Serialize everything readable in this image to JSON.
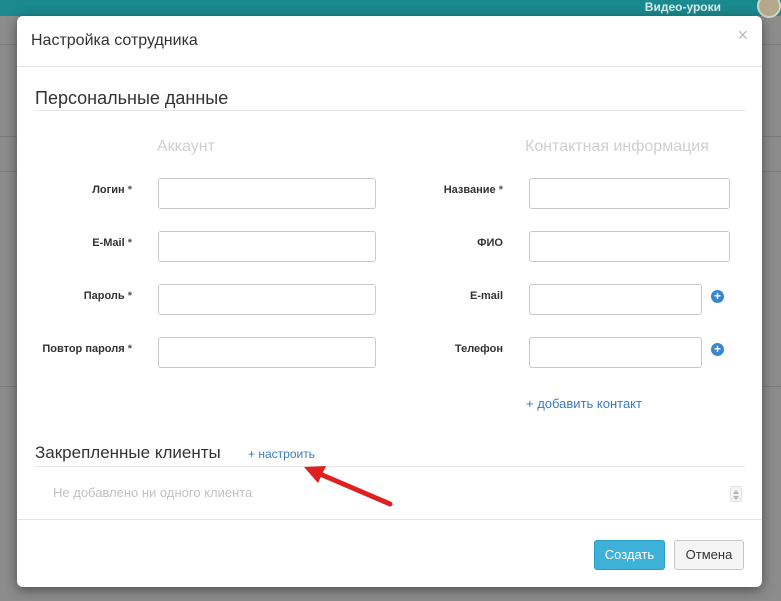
{
  "background": {
    "top_link": "Видео-уроки"
  },
  "modal": {
    "title": "Настройка сотрудника",
    "close_glyph": "×"
  },
  "personal": {
    "title": "Персональные данные",
    "account_header": "Аккаунт",
    "contact_header": "Контактная информация",
    "account_fields": [
      {
        "label": "Логин",
        "required": "*",
        "value": ""
      },
      {
        "label": "E-Mail",
        "required": "*",
        "value": ""
      },
      {
        "label": "Пароль",
        "required": "*",
        "value": ""
      },
      {
        "label": "Повтор пароля",
        "required": "*",
        "value": ""
      }
    ],
    "contact_fields": [
      {
        "label": "Название",
        "required": "*",
        "value": ""
      },
      {
        "label": "ФИО",
        "required": "",
        "value": ""
      },
      {
        "label": "E-mail",
        "required": "",
        "value": ""
      },
      {
        "label": "Телефон",
        "required": "",
        "value": ""
      }
    ],
    "add_contact": "+ добавить контакт"
  },
  "clients": {
    "title": "Закрепленные клиенты",
    "configure_link": "+ настроить",
    "empty_text": "Не добавлено ни одного клиента"
  },
  "footer": {
    "create_label": "Создать",
    "cancel_label": "Отмена"
  },
  "colors": {
    "primary": "#3db1d8",
    "link": "#3a7bbf",
    "annotation_arrow": "#e02020"
  }
}
